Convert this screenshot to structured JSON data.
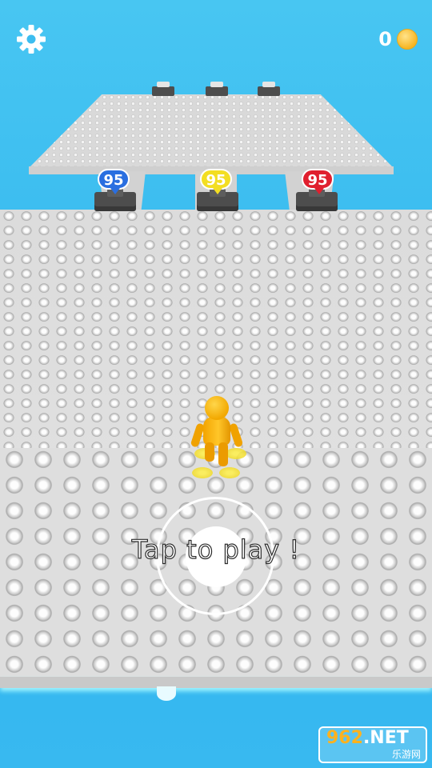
{
  "hud": {
    "settings_icon": "gear-icon",
    "coin_count": "0",
    "coin_icon": "coin-icon"
  },
  "enemies": [
    {
      "team": "blue",
      "strength": "95",
      "color": "#2a6fe0"
    },
    {
      "team": "yellow",
      "strength": "95",
      "color": "#f3de22"
    },
    {
      "team": "red",
      "strength": "95",
      "color": "#e01f2e"
    }
  ],
  "player": {
    "color": "#f5b400"
  },
  "prompt": {
    "text": "Tap to play !"
  },
  "watermark": {
    "number": "962",
    "suffix": ".NET",
    "subtitle": "乐游网"
  }
}
